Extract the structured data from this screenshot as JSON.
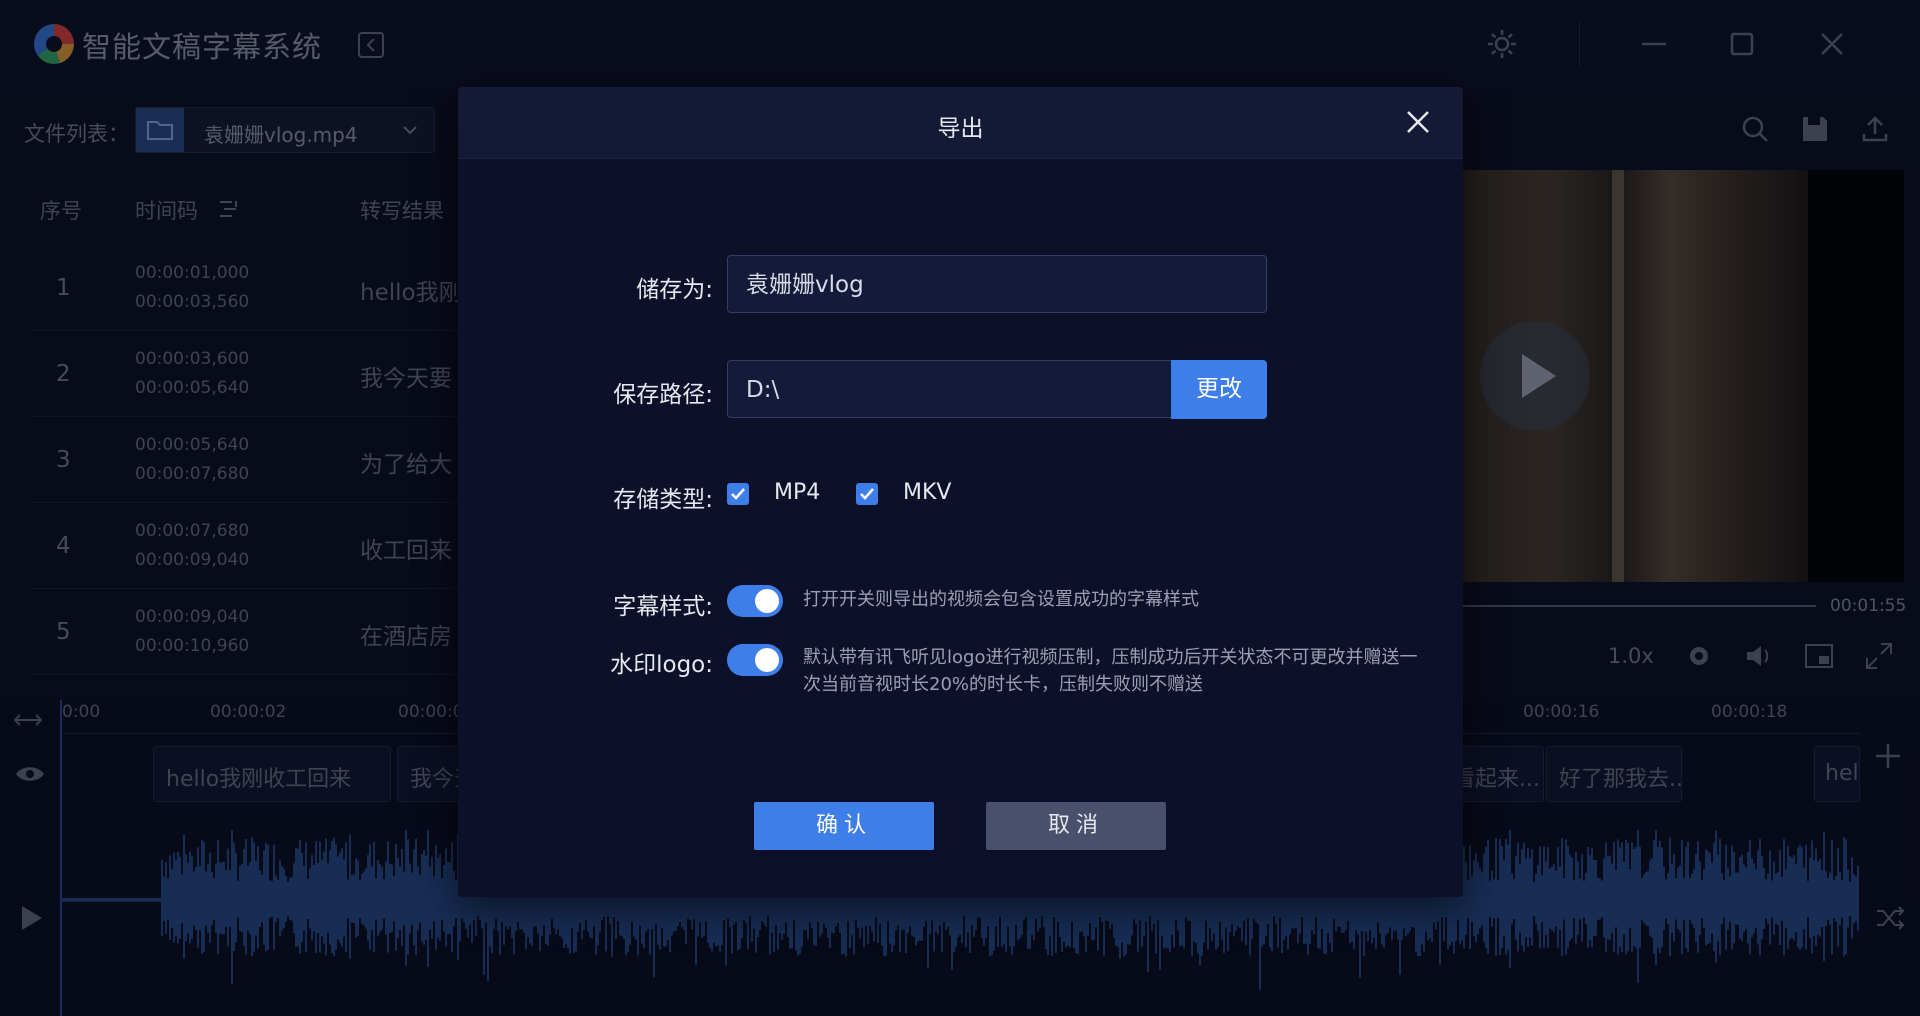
{
  "app": {
    "title": "智能文稿字幕系统"
  },
  "file_list": {
    "label": "文件列表：",
    "selected_file": "袁姗姗vlog.mp4"
  },
  "table": {
    "headers": {
      "index": "序号",
      "timecode": "时间码",
      "result": "转写结果"
    },
    "rows": [
      {
        "index": "1",
        "start": "00:00:01,000",
        "end": "00:00:03,560",
        "text": "hello我刚"
      },
      {
        "index": "2",
        "start": "00:00:03,600",
        "end": "00:00:05,640",
        "text": "我今天要"
      },
      {
        "index": "3",
        "start": "00:00:05,640",
        "end": "00:00:07,680",
        "text": "为了给大"
      },
      {
        "index": "4",
        "start": "00:00:07,680",
        "end": "00:00:09,040",
        "text": "收工回来"
      },
      {
        "index": "5",
        "start": "00:00:09,040",
        "end": "00:00:10,960",
        "text": "在酒店房"
      }
    ]
  },
  "player": {
    "duration": "00:01:55",
    "speed": "1.0x",
    "progress": 0.0
  },
  "timeline": {
    "ticks": [
      "0:00",
      "00:00:02",
      "00:00:0",
      "00:00:16",
      "00:00:18"
    ],
    "segments": [
      "hello我刚收工回来",
      "我今天",
      "看起来...",
      "好了那我去...",
      "hel"
    ]
  },
  "dialog": {
    "title": "导出",
    "save_as": {
      "label": "储存为:",
      "value": "袁姗姗vlog"
    },
    "save_path": {
      "label": "保存路径:",
      "value": "D:\\",
      "change_label": "更改"
    },
    "storage_type": {
      "label": "存储类型:",
      "options": [
        {
          "label": "MP4",
          "checked": true
        },
        {
          "label": "MKV",
          "checked": true
        }
      ]
    },
    "subtitle_style": {
      "label": "字幕样式:",
      "enabled": true,
      "hint": "打开开关则导出的视频会包含设置成功的字幕样式"
    },
    "watermark": {
      "label": "水印logo:",
      "enabled": true,
      "hint_line1": "默认带有讯飞听见logo进行视频压制，压制成功后开关状态不可更改并赠送一",
      "hint_line2": "次当前音视时长20%的时长卡，压制失败则不赠送"
    },
    "confirm_label": "确认",
    "cancel_label": "取消"
  }
}
